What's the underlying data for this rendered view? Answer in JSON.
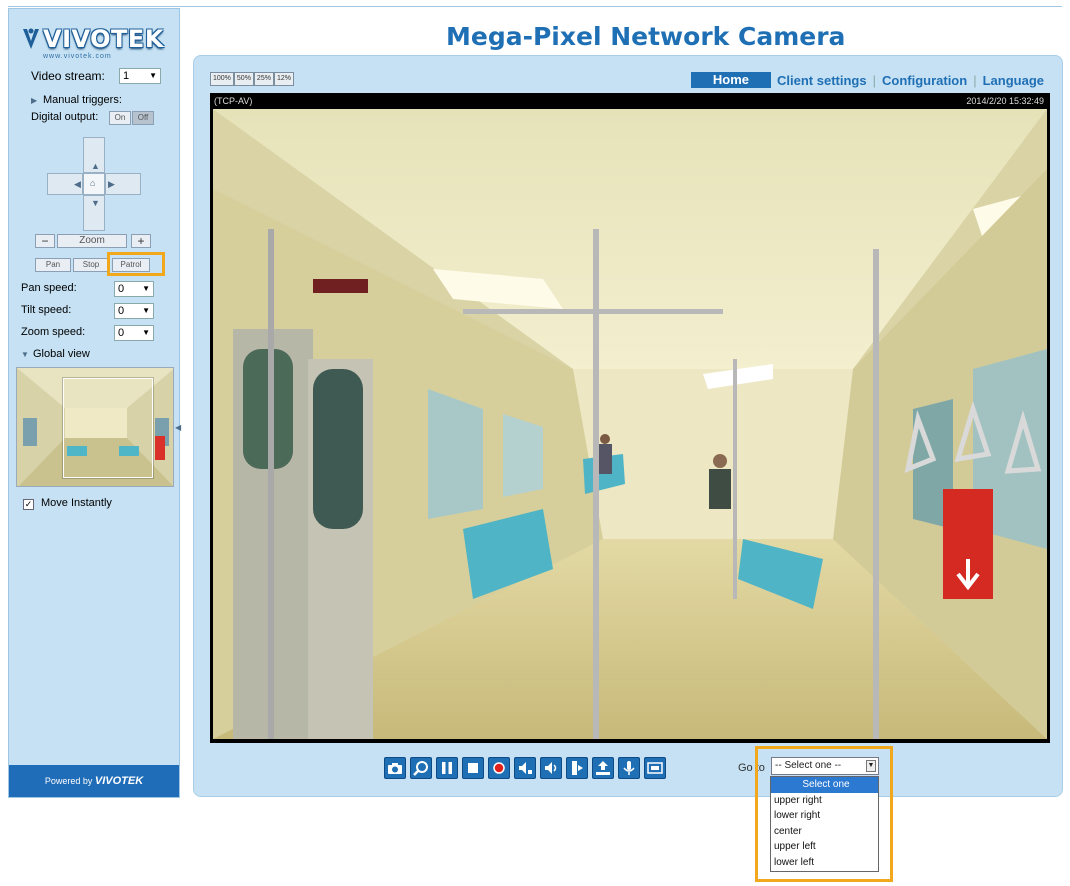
{
  "brand": {
    "name": "VIVOTEK",
    "tagline": "www.vivotek.com",
    "powered_by": "Powered by",
    "powered_brand": "VIVOTEK"
  },
  "header": {
    "title": "Mega-Pixel Network Camera"
  },
  "sidebar": {
    "video_stream_label": "Video stream:",
    "video_stream_value": "1",
    "manual_triggers_label": "Manual triggers:",
    "digital_output_label": "Digital output:",
    "digital_output_on": "On",
    "digital_output_off": "Off",
    "zoom_label": "Zoom",
    "zoom_minus": "−",
    "zoom_plus": "+",
    "pan_button": "Pan",
    "stop_button": "Stop",
    "patrol_button": "Patrol",
    "pan_speed_label": "Pan speed:",
    "pan_speed_value": "0",
    "tilt_speed_label": "Tilt speed:",
    "tilt_speed_value": "0",
    "zoom_speed_label": "Zoom speed:",
    "zoom_speed_value": "0",
    "global_view_label": "Global view",
    "move_instantly_label": "Move Instantly",
    "move_instantly_checked": "✓"
  },
  "resolution_buttons": [
    "100%",
    "50%",
    "25%",
    "12%"
  ],
  "nav": {
    "home": "Home",
    "client_settings": "Client settings",
    "configuration": "Configuration",
    "language": "Language"
  },
  "video": {
    "protocol": "(TCP-AV)",
    "timestamp": "2014/2/20 15:32:49"
  },
  "controls": [
    "snapshot",
    "digital-zoom",
    "pause",
    "stop",
    "record",
    "volume",
    "mute",
    "talk",
    "upload",
    "microphone",
    "fullscreen"
  ],
  "goto": {
    "label": "Go to",
    "selected": "-- Select one --",
    "options": [
      "Select one",
      "upper right",
      "lower right",
      "center",
      "upper left",
      "lower left"
    ]
  },
  "colors": {
    "accent": "#1f6fb5",
    "panel": "#c5e1f3",
    "highlight": "#f2a81d"
  }
}
